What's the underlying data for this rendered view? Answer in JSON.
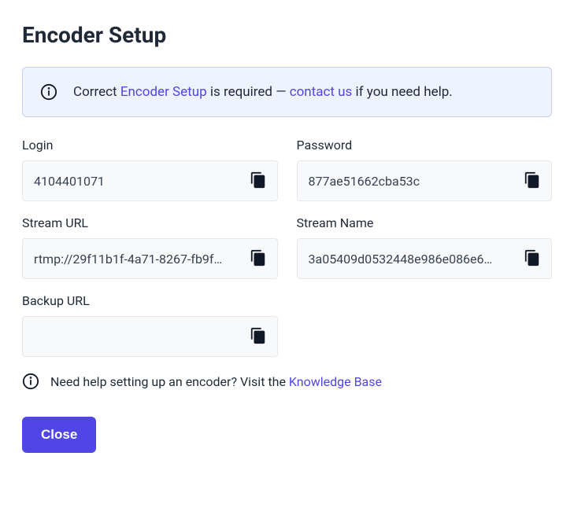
{
  "title": "Encoder Setup",
  "banner": {
    "prefix": "Correct ",
    "link1_text": "Encoder Setup",
    "middle": " is required — ",
    "link2_text": "contact us",
    "suffix": " if you need help."
  },
  "fields": {
    "login": {
      "label": "Login",
      "value": "4104401071"
    },
    "password": {
      "label": "Password",
      "value": "877ae51662cba53c"
    },
    "stream_url": {
      "label": "Stream URL",
      "value": "rtmp://29f11b1f-4a71-8267-fb9f…"
    },
    "stream_name": {
      "label": "Stream Name",
      "value": "3a05409d0532448e986e086e6…"
    },
    "backup_url": {
      "label": "Backup URL",
      "value": ""
    }
  },
  "help": {
    "prefix": "Need help setting up an encoder? Visit the ",
    "link_text": "Knowledge Base"
  },
  "close_label": "Close"
}
